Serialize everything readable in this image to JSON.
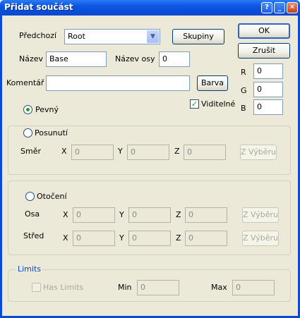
{
  "window": {
    "title": "Přidat součást",
    "help_glyph": "?",
    "min_glyph": "_",
    "close_glyph": "✕"
  },
  "form": {
    "predchozi_label": "Předchozí",
    "predchozi_value": "Root",
    "skupiny_label": "Skupiny",
    "ok_label": "OK",
    "zrusit_label": "Zrušit",
    "nazev_label": "Název",
    "nazev_value": "Base",
    "nazev_osy_label": "Název osy",
    "nazev_osy_value": "0",
    "komentar_label": "Komentář",
    "komentar_value": "",
    "barva_label": "Barva",
    "r_label": "R",
    "r_value": "0",
    "g_label": "G",
    "g_value": "0",
    "b_label": "B",
    "b_value": "0",
    "viditelne_label": "Viditelné",
    "viditelne_checked": true,
    "pevny_label": "Pevný",
    "pevny_selected": true
  },
  "posunuti": {
    "label": "Posunutí",
    "smer_label": "Směr",
    "x_label": "X",
    "x_value": "0",
    "y_label": "Y",
    "y_value": "0",
    "z_label": "Z",
    "z_value": "0",
    "z_vyberu_label": "Z Výběru"
  },
  "otoceni": {
    "label": "Otočení",
    "osa_label": "Osa",
    "osa_x_label": "X",
    "osa_x_value": "0",
    "osa_y_label": "Y",
    "osa_y_value": "0",
    "osa_z_label": "Z",
    "osa_z_value": "0",
    "osa_z_vyberu_label": "Z Výběru",
    "stred_label": "Střed",
    "stred_x_label": "X",
    "stred_x_value": "0",
    "stred_y_label": "Y",
    "stred_y_value": "0",
    "stred_z_label": "Z",
    "stred_z_value": "0",
    "stred_z_vyberu_label": "Z Výběru"
  },
  "limits": {
    "label": "Limits",
    "has_limits_label": "Has Limits",
    "min_label": "Min",
    "min_value": "0",
    "max_label": "Max",
    "max_value": "0"
  }
}
